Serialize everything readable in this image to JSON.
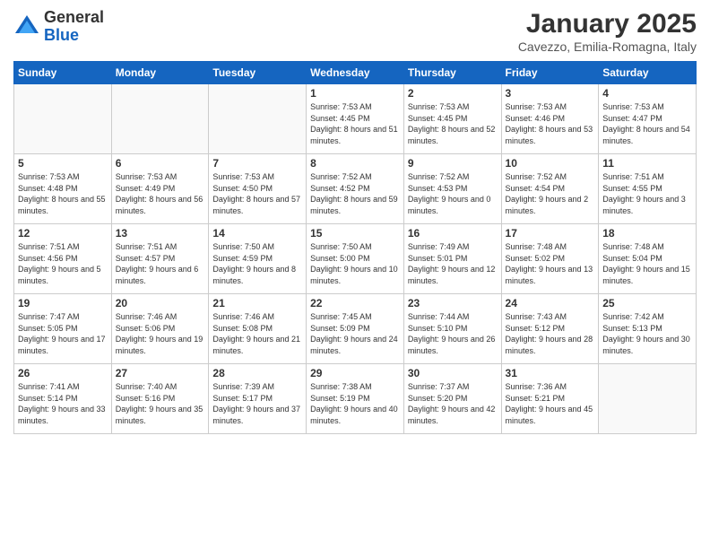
{
  "logo": {
    "general": "General",
    "blue": "Blue"
  },
  "title": "January 2025",
  "location": "Cavezzo, Emilia-Romagna, Italy",
  "days_of_week": [
    "Sunday",
    "Monday",
    "Tuesday",
    "Wednesday",
    "Thursday",
    "Friday",
    "Saturday"
  ],
  "weeks": [
    [
      {
        "day": "",
        "info": ""
      },
      {
        "day": "",
        "info": ""
      },
      {
        "day": "",
        "info": ""
      },
      {
        "day": "1",
        "info": "Sunrise: 7:53 AM\nSunset: 4:45 PM\nDaylight: 8 hours and 51 minutes."
      },
      {
        "day": "2",
        "info": "Sunrise: 7:53 AM\nSunset: 4:45 PM\nDaylight: 8 hours and 52 minutes."
      },
      {
        "day": "3",
        "info": "Sunrise: 7:53 AM\nSunset: 4:46 PM\nDaylight: 8 hours and 53 minutes."
      },
      {
        "day": "4",
        "info": "Sunrise: 7:53 AM\nSunset: 4:47 PM\nDaylight: 8 hours and 54 minutes."
      }
    ],
    [
      {
        "day": "5",
        "info": "Sunrise: 7:53 AM\nSunset: 4:48 PM\nDaylight: 8 hours and 55 minutes."
      },
      {
        "day": "6",
        "info": "Sunrise: 7:53 AM\nSunset: 4:49 PM\nDaylight: 8 hours and 56 minutes."
      },
      {
        "day": "7",
        "info": "Sunrise: 7:53 AM\nSunset: 4:50 PM\nDaylight: 8 hours and 57 minutes."
      },
      {
        "day": "8",
        "info": "Sunrise: 7:52 AM\nSunset: 4:52 PM\nDaylight: 8 hours and 59 minutes."
      },
      {
        "day": "9",
        "info": "Sunrise: 7:52 AM\nSunset: 4:53 PM\nDaylight: 9 hours and 0 minutes."
      },
      {
        "day": "10",
        "info": "Sunrise: 7:52 AM\nSunset: 4:54 PM\nDaylight: 9 hours and 2 minutes."
      },
      {
        "day": "11",
        "info": "Sunrise: 7:51 AM\nSunset: 4:55 PM\nDaylight: 9 hours and 3 minutes."
      }
    ],
    [
      {
        "day": "12",
        "info": "Sunrise: 7:51 AM\nSunset: 4:56 PM\nDaylight: 9 hours and 5 minutes."
      },
      {
        "day": "13",
        "info": "Sunrise: 7:51 AM\nSunset: 4:57 PM\nDaylight: 9 hours and 6 minutes."
      },
      {
        "day": "14",
        "info": "Sunrise: 7:50 AM\nSunset: 4:59 PM\nDaylight: 9 hours and 8 minutes."
      },
      {
        "day": "15",
        "info": "Sunrise: 7:50 AM\nSunset: 5:00 PM\nDaylight: 9 hours and 10 minutes."
      },
      {
        "day": "16",
        "info": "Sunrise: 7:49 AM\nSunset: 5:01 PM\nDaylight: 9 hours and 12 minutes."
      },
      {
        "day": "17",
        "info": "Sunrise: 7:48 AM\nSunset: 5:02 PM\nDaylight: 9 hours and 13 minutes."
      },
      {
        "day": "18",
        "info": "Sunrise: 7:48 AM\nSunset: 5:04 PM\nDaylight: 9 hours and 15 minutes."
      }
    ],
    [
      {
        "day": "19",
        "info": "Sunrise: 7:47 AM\nSunset: 5:05 PM\nDaylight: 9 hours and 17 minutes."
      },
      {
        "day": "20",
        "info": "Sunrise: 7:46 AM\nSunset: 5:06 PM\nDaylight: 9 hours and 19 minutes."
      },
      {
        "day": "21",
        "info": "Sunrise: 7:46 AM\nSunset: 5:08 PM\nDaylight: 9 hours and 21 minutes."
      },
      {
        "day": "22",
        "info": "Sunrise: 7:45 AM\nSunset: 5:09 PM\nDaylight: 9 hours and 24 minutes."
      },
      {
        "day": "23",
        "info": "Sunrise: 7:44 AM\nSunset: 5:10 PM\nDaylight: 9 hours and 26 minutes."
      },
      {
        "day": "24",
        "info": "Sunrise: 7:43 AM\nSunset: 5:12 PM\nDaylight: 9 hours and 28 minutes."
      },
      {
        "day": "25",
        "info": "Sunrise: 7:42 AM\nSunset: 5:13 PM\nDaylight: 9 hours and 30 minutes."
      }
    ],
    [
      {
        "day": "26",
        "info": "Sunrise: 7:41 AM\nSunset: 5:14 PM\nDaylight: 9 hours and 33 minutes."
      },
      {
        "day": "27",
        "info": "Sunrise: 7:40 AM\nSunset: 5:16 PM\nDaylight: 9 hours and 35 minutes."
      },
      {
        "day": "28",
        "info": "Sunrise: 7:39 AM\nSunset: 5:17 PM\nDaylight: 9 hours and 37 minutes."
      },
      {
        "day": "29",
        "info": "Sunrise: 7:38 AM\nSunset: 5:19 PM\nDaylight: 9 hours and 40 minutes."
      },
      {
        "day": "30",
        "info": "Sunrise: 7:37 AM\nSunset: 5:20 PM\nDaylight: 9 hours and 42 minutes."
      },
      {
        "day": "31",
        "info": "Sunrise: 7:36 AM\nSunset: 5:21 PM\nDaylight: 9 hours and 45 minutes."
      },
      {
        "day": "",
        "info": ""
      }
    ]
  ]
}
